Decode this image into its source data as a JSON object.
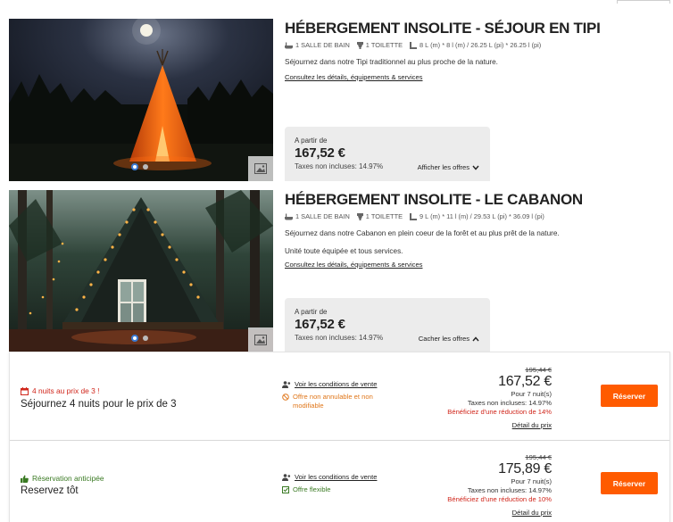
{
  "rooms": [
    {
      "title": "HÉBERGEMENT INSOLITE - SÉJOUR EN TIPI",
      "amenities": {
        "bath": "1 SALLE DE BAIN",
        "toilet": "1 TOILETTE",
        "size": "8 L (m) * 8 l (m) / 26.25 L (pi) * 26.25 l (pi)"
      },
      "description": "Séjournez dans notre Tipi traditionnel au plus proche de la nature.",
      "description2": "",
      "details_link": "Consultez les détails, équipements & services",
      "price": {
        "from_label": "A partir de",
        "amount": "167,52 €",
        "tax_note": "Taxes non incluses: 14.97%",
        "toggle_label": "Afficher les offres"
      },
      "toggle_icon": "chevron-down-icon"
    },
    {
      "title": "HÉBERGEMENT INSOLITE - LE CABANON",
      "amenities": {
        "bath": "1 SALLE DE BAIN",
        "toilet": "1 TOILETTE",
        "size": "9 L (m) * 11 l (m) / 29.53 L (pi) * 36.09 l (pi)"
      },
      "description": "Séjournez dans notre Cabanon en plein coeur de la forêt et au plus prêt de la nature.",
      "description2": "Unité toute équipée et tous services.",
      "details_link": "Consultez les détails, équipements & services",
      "price": {
        "from_label": "A partir de",
        "amount": "167,52 €",
        "tax_note": "Taxes non incluses: 14.97%",
        "toggle_label": "Cacher les offres"
      },
      "toggle_icon": "chevron-up-icon"
    }
  ],
  "offers": [
    {
      "tag": "4 nuits au prix de 3 !",
      "tag_icon": "calendar-icon",
      "name": "Séjournez 4 nuits pour le prix de 3",
      "conditions_link": "Voir les conditions de vente",
      "condition_note": "Offre non annulable et non modifiable",
      "condition_icon": "no-cancel-icon",
      "old_price": "195,44 €",
      "price": "167,52 €",
      "nights": "Pour 7 nuit(s)",
      "taxes": "Taxes non incluses: 14.97%",
      "discount": "Bénéficiez d'une réduction de 14%",
      "detail_link": "Détail du prix",
      "reserve": "Réserver"
    },
    {
      "tag": "Réservation anticipée",
      "tag_icon": "thumbs-up-icon",
      "name": "Reservez tôt",
      "conditions_link": "Voir les conditions de vente",
      "condition_note": "Offre flexible",
      "condition_icon": "flexible-icon",
      "old_price": "195,44 €",
      "price": "175,89 €",
      "nights": "Pour 7 nuit(s)",
      "taxes": "Taxes non incluses: 14.97%",
      "discount": "Bénéficiez d'une réduction de 10%",
      "detail_link": "Détail du prix",
      "reserve": "Réserver"
    }
  ],
  "colors": {
    "accent": "#ff5b00",
    "discount": "#d0261b",
    "warning": "#e0771b",
    "flexible": "#3a7a23",
    "price_box": "#ececec"
  }
}
